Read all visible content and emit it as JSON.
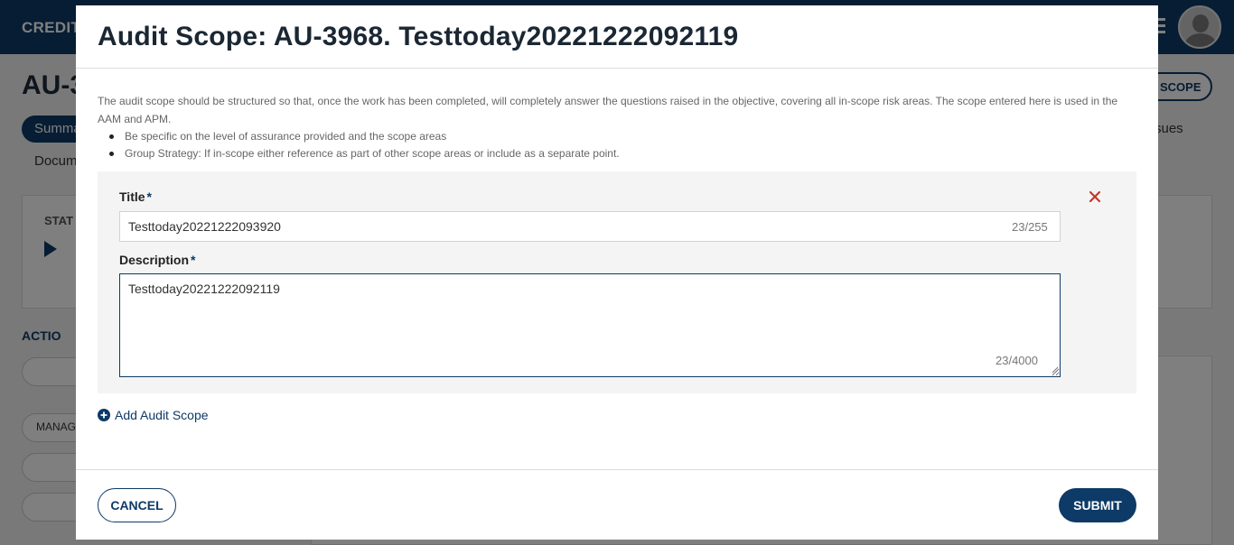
{
  "background": {
    "brand": "CREDIT",
    "page_title": "AU-3",
    "scope_button": "SCOPE",
    "tab_summary": "Summa",
    "tab_documents": "Docum",
    "tab_issues": "sues",
    "status_label": "STAT",
    "actions_label": "ACTIO",
    "manage_label": "MANAG"
  },
  "modal": {
    "title": "Audit Scope: AU-3968. Testtoday20221222092119",
    "intro": "The audit scope should be structured so that, once the work has been completed, will completely answer the questions raised in the objective, covering all in-scope risk areas. The scope entered here is used in the AAM and APM.",
    "bullets": [
      "Be specific on the level of assurance provided and the scope areas",
      "Group Strategy: If in-scope either reference as part of other scope areas or include as a separate point."
    ],
    "scope_item": {
      "title_label": "Title",
      "required_mark": "*",
      "title_value": "Testtoday20221222093920",
      "title_counter": "23/255",
      "description_label": "Description",
      "description_value": "Testtoday20221222092119",
      "description_counter": "23/4000"
    },
    "add_scope_label": "Add Audit Scope",
    "cancel_label": "CANCEL",
    "submit_label": "SUBMIT"
  },
  "colors": {
    "primary": "#0d3a66",
    "danger": "#c0392b",
    "panel_bg": "#f4f4f4"
  }
}
